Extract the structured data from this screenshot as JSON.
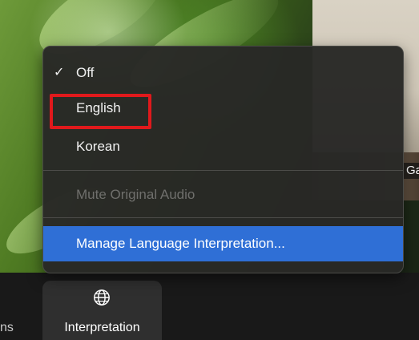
{
  "menu": {
    "items": [
      {
        "label": "Off",
        "checked": true
      },
      {
        "label": "English",
        "checked": false,
        "highlighted_annotation": true
      },
      {
        "label": "Korean",
        "checked": false
      }
    ],
    "mute_label": "Mute Original Audio",
    "manage_label": "Manage Language Interpretation..."
  },
  "toolbar": {
    "left_partial_label": "ns",
    "interpretation_label": "Interpretation",
    "interpretation_icon": "globe-icon"
  },
  "participant": {
    "name_partial": "Ga"
  },
  "colors": {
    "menu_bg": "#282826",
    "highlight": "#2f6fd6",
    "annotation": "#e0191c"
  }
}
